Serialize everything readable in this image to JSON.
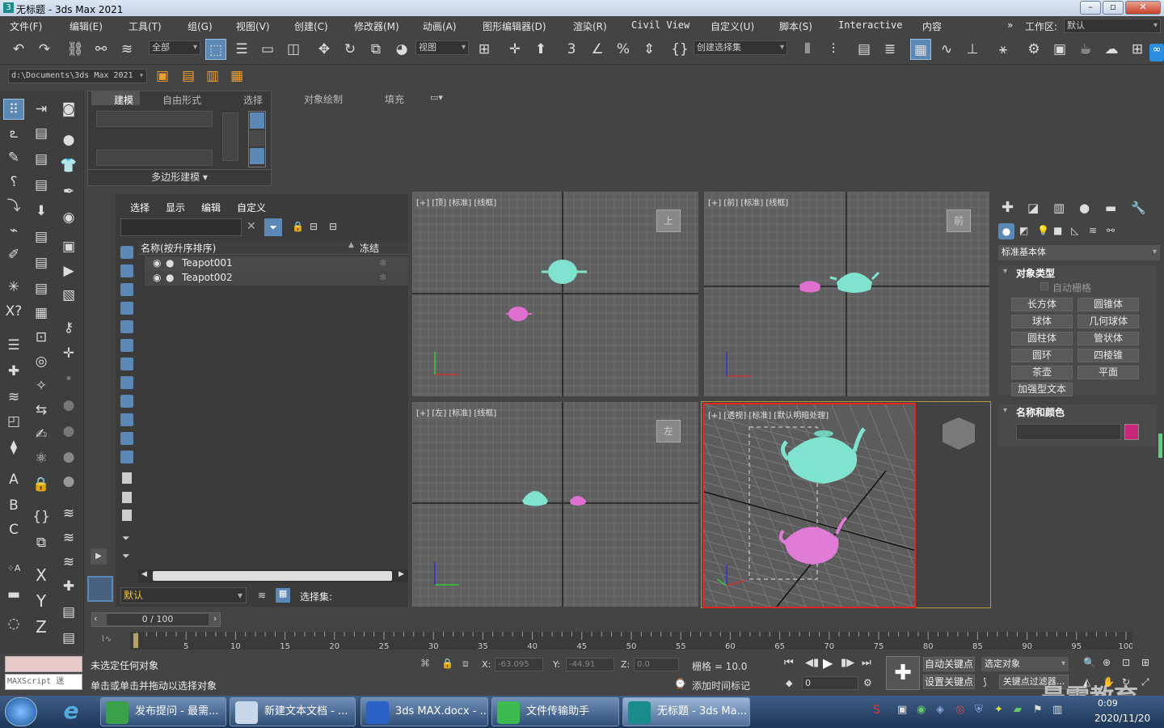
{
  "window": {
    "title": "无标题 - 3ds Max 2021"
  },
  "menu": [
    "文件(F)",
    "编辑(E)",
    "工具(T)",
    "组(G)",
    "视图(V)",
    "创建(C)",
    "修改器(M)",
    "动画(A)",
    "图形编辑器(D)",
    "渲染(R)",
    "Civil View",
    "自定义(U)",
    "脚本(S)",
    "Interactive",
    "内容"
  ],
  "workspace": {
    "label": "工作区:",
    "value": "默认"
  },
  "toolbar": {
    "filter": "全部",
    "ref_coord": "视图",
    "selection_set": "创建选择集"
  },
  "path": "d:\\Documents\\3ds Max 2021",
  "ribbon": {
    "tabs": [
      "建模",
      "自由形式",
      "选择",
      "对象绘制",
      "填充"
    ],
    "group": "多边形建模"
  },
  "explorer": {
    "menu": [
      "选择",
      "显示",
      "编辑",
      "自定义"
    ],
    "col_name": "名称(按升序排序)",
    "col_freeze": "冻结",
    "items": [
      "Teapot001",
      "Teapot002"
    ],
    "layer": "默认",
    "selset_label": "选择集:"
  },
  "viewports": {
    "top": "[+] [顶] [标准] [线框]",
    "front": "[+] [前] [标准] [线框]",
    "left": "[+] [左] [标准] [线框]",
    "persp": "[+] [透视] [标准] [默认明暗处理]",
    "cube_top": "上",
    "cube_front": "前",
    "cube_left": "左"
  },
  "command_panel": {
    "category": "标准基本体",
    "rollout1": "对象类型",
    "autogrid": "自动栅格",
    "buttons": [
      "长方体",
      "圆锥体",
      "球体",
      "几何球体",
      "圆柱体",
      "管状体",
      "圆环",
      "四棱锥",
      "茶壶",
      "平面",
      "加强型文本"
    ],
    "rollout2": "名称和颜色",
    "swatch": "#c8287a"
  },
  "timeline": {
    "frame": "0 / 100",
    "ticks": [
      "5",
      "10",
      "15",
      "20",
      "25",
      "30",
      "35",
      "40",
      "45",
      "50",
      "55",
      "60",
      "65",
      "70",
      "75",
      "80",
      "85",
      "90",
      "95",
      "100"
    ],
    "start": "0"
  },
  "status": {
    "maxscript": "MAXScript 迷",
    "line1": "未选定任何对象",
    "line2": "单击或单击并拖动以选择对象",
    "x_label": "X:",
    "x": "-63.095",
    "y_label": "Y:",
    "y": "-44.91",
    "z_label": "Z:",
    "z": "0.0",
    "grid": "栅格 = 10.0",
    "add_time_tag": "添加时间标记",
    "auto_key": "自动关键点",
    "set_key": "设置关键点",
    "sel_obj": "选定对象",
    "key_filter": "关键点过滤器...",
    "frame_field": "0"
  },
  "taskbar": {
    "tasks": [
      "发布提问 - 最需...",
      "新建文本文档 - ...",
      "3ds MAX.docx - ...",
      "文件传输助手",
      "无标题 - 3ds Ma..."
    ],
    "time": "0:09",
    "date": "2020/11/20",
    "watermark": "最需教育"
  },
  "colors": {
    "teal": "#7fe3cf",
    "pink": "#e070d0",
    "select_border": "#e0281e"
  }
}
